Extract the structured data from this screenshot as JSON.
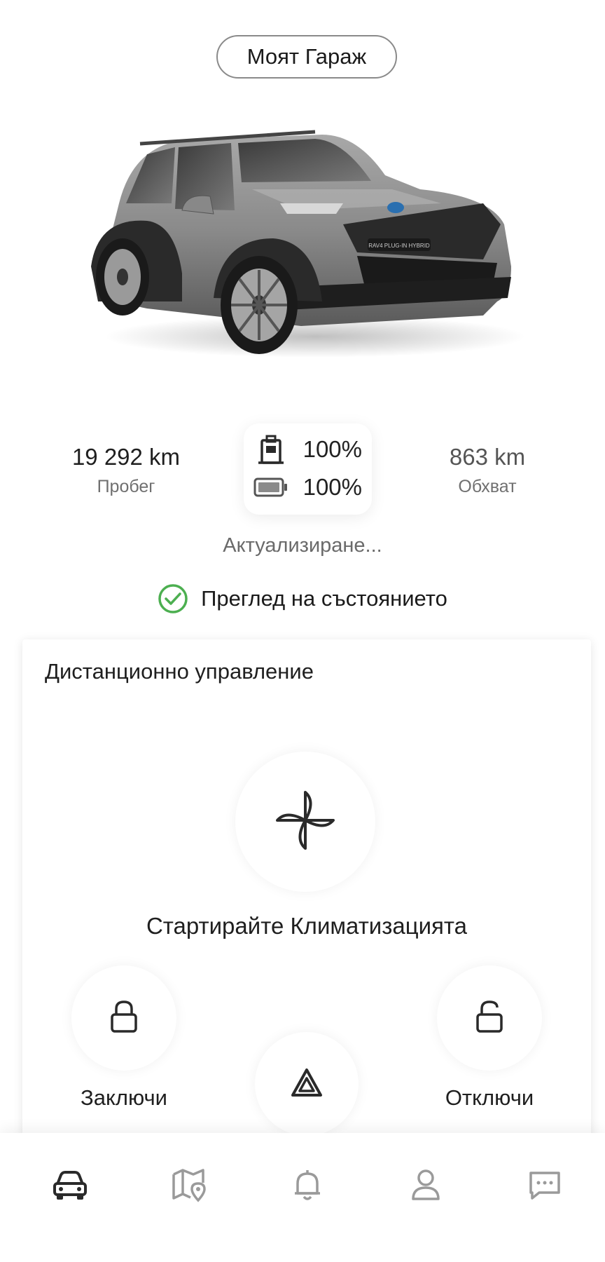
{
  "header": {
    "garage_label": "Моят Гараж"
  },
  "vehicle": {
    "badge_text": "RAV4 PLUG-IN HYBRID"
  },
  "stats": {
    "mileage_value": "19 292 km",
    "mileage_label": "Пробег",
    "fuel_percent": "100%",
    "battery_percent": "100%",
    "range_value": "863 km",
    "range_label": "Обхват"
  },
  "status": {
    "updating_text": "Актуализиране...",
    "health_check_label": "Преглед на състоянието"
  },
  "remote": {
    "title": "Дистанционно управление",
    "climate_label": "Стартирайте Климатизацията",
    "lock_label": "Заключи",
    "unlock_label": "Отключи"
  },
  "nav": {
    "items": [
      {
        "icon": "car-icon",
        "active": true
      },
      {
        "icon": "map-pin-icon",
        "active": false
      },
      {
        "icon": "bell-icon",
        "active": false
      },
      {
        "icon": "user-icon",
        "active": false
      },
      {
        "icon": "chat-icon",
        "active": false
      }
    ]
  },
  "colors": {
    "accent_green": "#4caf50",
    "active_icon": "#2a2a2a",
    "inactive_icon": "#9a9a9a"
  }
}
